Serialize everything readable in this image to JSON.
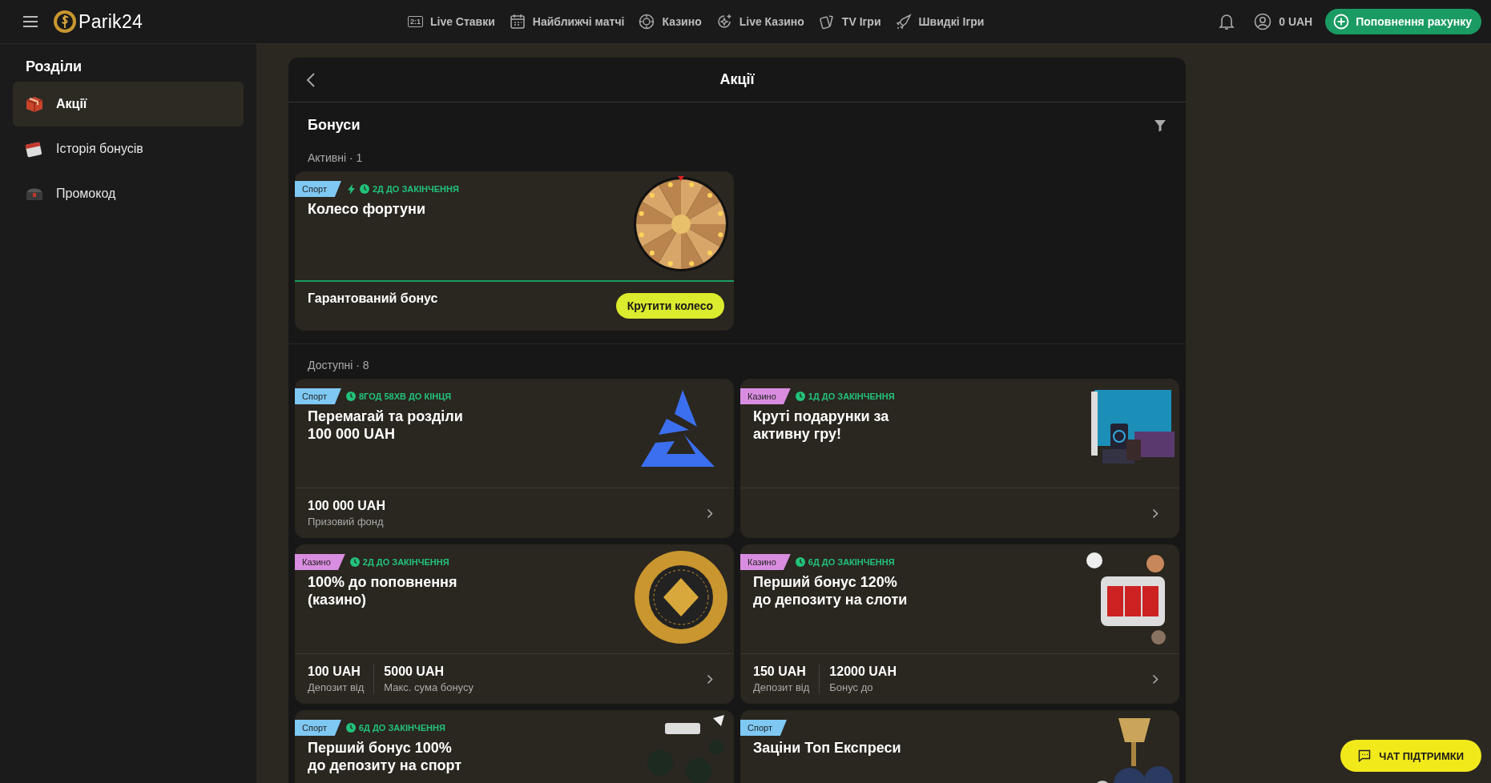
{
  "header": {
    "brand": "Parik24",
    "nav": [
      {
        "label": "Live Ставки",
        "badge": "2:1"
      },
      {
        "label": "Найближчі матчі"
      },
      {
        "label": "Казино"
      },
      {
        "label": "Live Казино"
      },
      {
        "label": "TV Ігри"
      },
      {
        "label": "Швидкі Ігри"
      }
    ],
    "balance": "0 UAH",
    "deposit_button": "Поповнення рахунку"
  },
  "sidebar": {
    "title": "Розділи",
    "items": [
      {
        "label": "Акції",
        "selected": true
      },
      {
        "label": "Історія бонусів",
        "selected": false
      },
      {
        "label": "Промокод",
        "selected": false
      }
    ]
  },
  "page": {
    "title": "Акції",
    "section_title": "Бонуси",
    "groups": [
      {
        "heading": "Активні · 1",
        "cards": [
          {
            "tag": {
              "label": "Спорт",
              "kind": "sport"
            },
            "boosted": true,
            "timer": "2Д ДО ЗАКІНЧЕННЯ",
            "title": "Колесо фортуни",
            "footer": {
              "kind": "action",
              "text": "Гарантований бонус",
              "button": "Крутити колесо"
            }
          }
        ]
      },
      {
        "heading": "Доступні · 8",
        "cards": [
          {
            "tag": {
              "label": "Спорт",
              "kind": "sport"
            },
            "boosted": false,
            "timer": "8ГОД 58ХВ ДО КІНЦЯ",
            "title": "Перемагай та розділи\n100 000 UAH",
            "footer": {
              "kind": "stats",
              "stats": [
                {
                  "value": "100 000 UAH",
                  "label": "Призовий фонд"
                }
              ]
            }
          },
          {
            "tag": {
              "label": "Казино",
              "kind": "casino"
            },
            "boosted": false,
            "timer": "1Д ДО ЗАКІНЧЕННЯ",
            "title": "Круті подарунки за\nактивну гру!",
            "footer": {
              "kind": "stats"
            }
          },
          {
            "tag": {
              "label": "Казино",
              "kind": "casino"
            },
            "boosted": false,
            "timer": "2Д ДО ЗАКІНЧЕННЯ",
            "title": "100% до поповнення\n(казино)",
            "footer": {
              "kind": "stats",
              "stats": [
                {
                  "value": "100 UAH",
                  "label": "Депозит від"
                },
                {
                  "value": "5000 UAH",
                  "label": "Макс. сума бонусу"
                }
              ]
            }
          },
          {
            "tag": {
              "label": "Казино",
              "kind": "casino"
            },
            "boosted": false,
            "timer": "6Д ДО ЗАКІНЧЕННЯ",
            "title": "Перший бонус 120%\nдо депозиту на слоти",
            "footer": {
              "kind": "stats",
              "stats": [
                {
                  "value": "150 UAH",
                  "label": "Депозит від"
                },
                {
                  "value": "12000 UAH",
                  "label": "Бонус до"
                }
              ]
            }
          },
          {
            "tag": {
              "label": "Спорт",
              "kind": "sport"
            },
            "boosted": false,
            "timer": "6Д ДО ЗАКІНЧЕННЯ",
            "title": "Перший бонус 100%\nдо депозиту на спорт"
          },
          {
            "tag": {
              "label": "Спорт",
              "kind": "sport"
            },
            "boosted": false,
            "title": "Заціни Топ Експреси"
          }
        ]
      }
    ]
  },
  "support_button": "ЧАТ ПІДТРИМКИ"
}
